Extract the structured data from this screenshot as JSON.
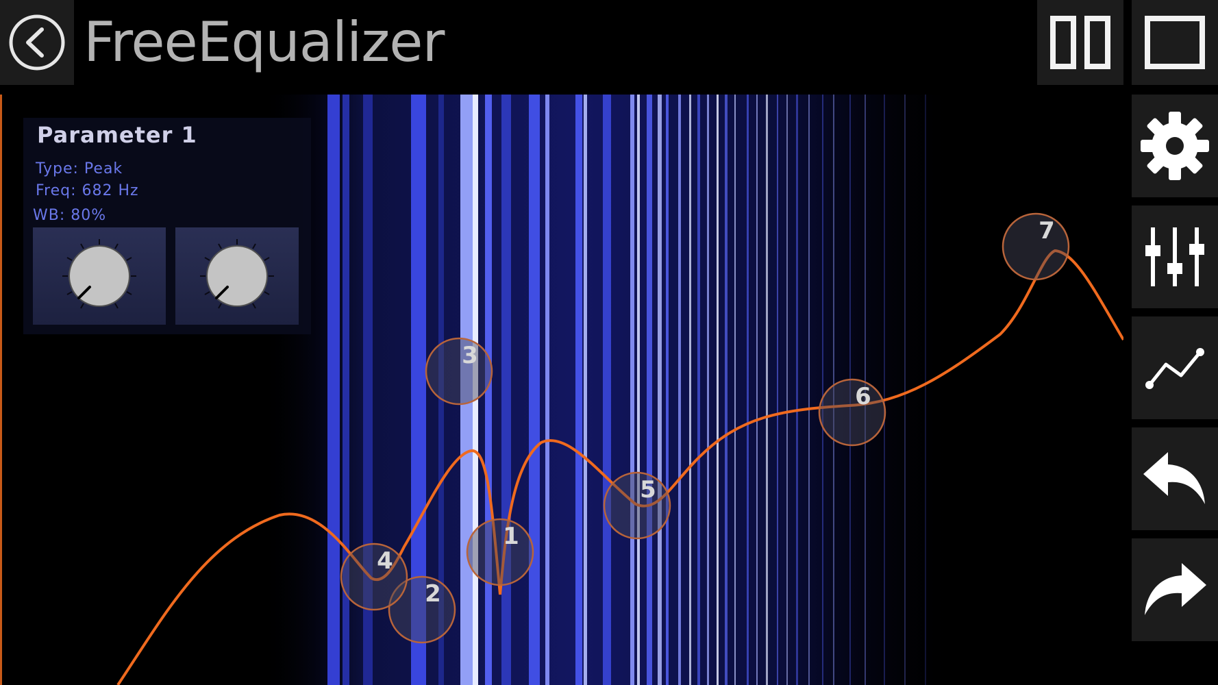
{
  "header": {
    "title": "FreeEqualizer"
  },
  "icons": {
    "back": "back-arrow-icon",
    "split": "split-view-icon",
    "fullscreen": "fullscreen-icon",
    "settings": "gear-icon",
    "mixer": "sliders-icon",
    "graph": "line-chart-icon",
    "undo": "undo-icon",
    "redo": "redo-icon"
  },
  "parameter_panel": {
    "title": "Parameter  1",
    "type_line": "Type: Peak",
    "freq_line": "Freq: 682 Hz",
    "wb_line": "WB: 80%"
  },
  "eq_nodes": [
    "1",
    "2",
    "3",
    "4",
    "5",
    "6",
    "7"
  ],
  "colors": {
    "curve": "#f06a1e",
    "spectrum": "#4a5cff",
    "button_bg": "#1c1c1c",
    "panel_text": "#6a78ea"
  }
}
